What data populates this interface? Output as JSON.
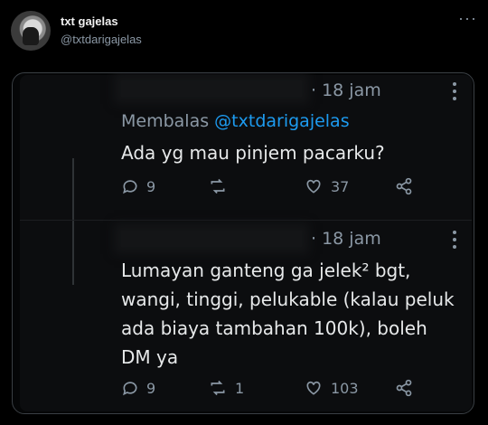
{
  "tweet": {
    "display_name": "txt gajelas",
    "username": "@txtdarigajelas",
    "more_icon": "more-horizontal-icon"
  },
  "screenshot": {
    "first": {
      "time": "· 18 jam",
      "replying_prefix": "Membalas",
      "replying_handle": "@txtdarigajelas",
      "text": "Ada yg mau pinjem pacarku?",
      "replies": "9",
      "retweets": "",
      "likes": "37"
    },
    "second": {
      "time": "· 18 jam",
      "lines": [
        "Lumayan ganteng ga jelek² bgt,",
        "wangi, tinggi, pelukable (kalau peluk",
        "ada biaya tambahan 100k), boleh",
        "DM ya"
      ],
      "replies": "9",
      "retweets": "1",
      "likes": "103"
    }
  },
  "colors": {
    "background": "#000000",
    "text": "#e7e9ea",
    "muted": "#8b98a5",
    "link": "#1d9bf0"
  }
}
